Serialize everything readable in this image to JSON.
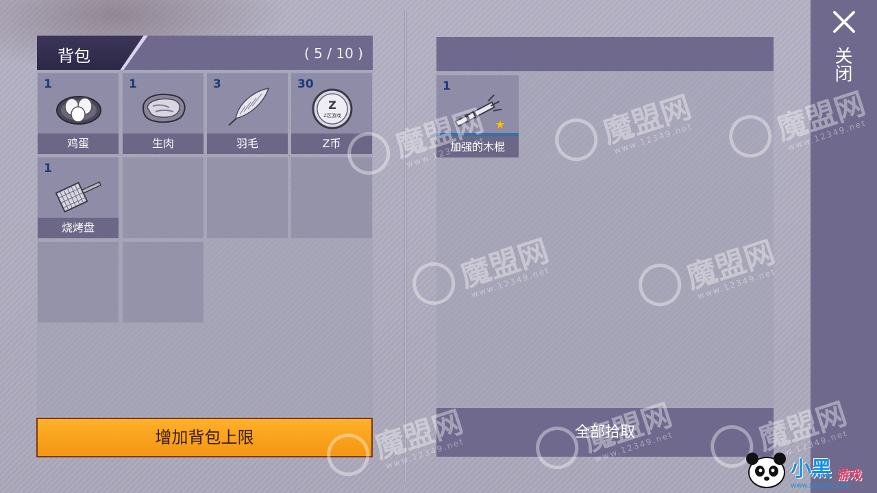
{
  "backpack": {
    "title": "背包",
    "capacity": "( 5 / 10 )",
    "items": [
      {
        "qty": "1",
        "name": "鸡蛋",
        "icon": "eggs-nest-icon"
      },
      {
        "qty": "1",
        "name": "生肉",
        "icon": "raw-meat-icon"
      },
      {
        "qty": "3",
        "name": "羽毛",
        "icon": "feather-icon"
      },
      {
        "qty": "30",
        "name": "Z币",
        "icon": "z-coin-icon",
        "coin_text": "Z区游戏"
      },
      {
        "qty": "1",
        "name": "烧烤盘",
        "icon": "grill-pan-icon"
      }
    ],
    "expand_button": "增加背包上限"
  },
  "loot": {
    "items": [
      {
        "qty": "1",
        "name": "加强的木棍",
        "icon": "reinforced-stick-icon",
        "rarity_icon": "star-icon"
      }
    ],
    "pick_all_button": "全部拾取"
  },
  "close": {
    "label": "关闭",
    "icon": "close-icon"
  },
  "watermark": {
    "text": "魔盟网",
    "url": "www.12349.net"
  },
  "brand": {
    "title": "小黑",
    "sub": "游戏",
    "url": "www.xiaohei.com"
  },
  "colors": {
    "header": "#6f6a8d",
    "button_orange": "#f7a11c",
    "qty_blue": "#1e3a78",
    "star": "#f5c21b"
  }
}
